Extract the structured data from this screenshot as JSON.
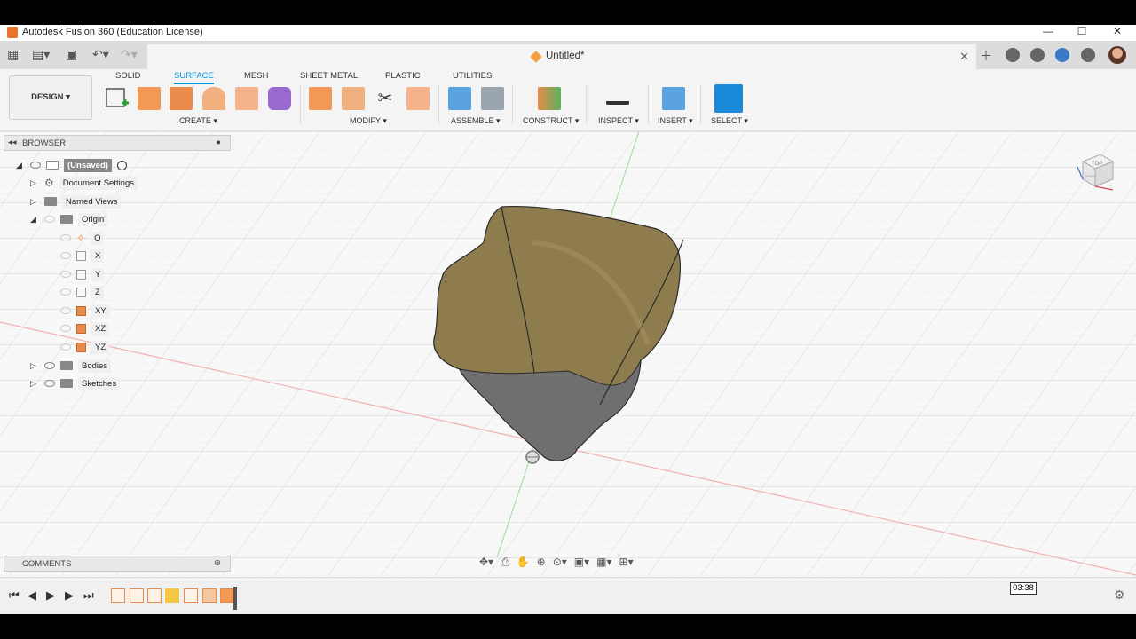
{
  "window": {
    "title": "Autodesk Fusion 360 (Education License)",
    "minimize": "—",
    "maximize": "☐",
    "close": "✕"
  },
  "document": {
    "tab_name": "Untitled*",
    "close": "✕"
  },
  "ribbon": {
    "tabs": [
      "SOLID",
      "SURFACE",
      "MESH",
      "SHEET METAL",
      "PLASTIC",
      "UTILITIES"
    ],
    "active_tab": "SURFACE",
    "workspace": "DESIGN ▾",
    "groups": [
      "CREATE ▾",
      "MODIFY ▾",
      "ASSEMBLE ▾",
      "CONSTRUCT ▾",
      "INSPECT ▾",
      "INSERT ▾",
      "SELECT ▾"
    ]
  },
  "browser": {
    "header": "BROWSER",
    "root": "(Unsaved)",
    "items": [
      {
        "label": "Document Settings"
      },
      {
        "label": "Named Views"
      },
      {
        "label": "Origin"
      },
      {
        "label": "O"
      },
      {
        "label": "X"
      },
      {
        "label": "Y"
      },
      {
        "label": "Z"
      },
      {
        "label": "XY"
      },
      {
        "label": "XZ"
      },
      {
        "label": "YZ"
      },
      {
        "label": "Bodies"
      },
      {
        "label": "Sketches"
      }
    ]
  },
  "comments": {
    "header": "COMMENTS"
  },
  "viewcube": {
    "top": "TOP",
    "front": "FRONT"
  },
  "timeline": {
    "timestamp": "03:38"
  },
  "colors": {
    "accent": "#0696d7",
    "surface_tan": "#8e7c4e",
    "surface_gray": "#707070",
    "feature_orange": "#e88a4a"
  }
}
